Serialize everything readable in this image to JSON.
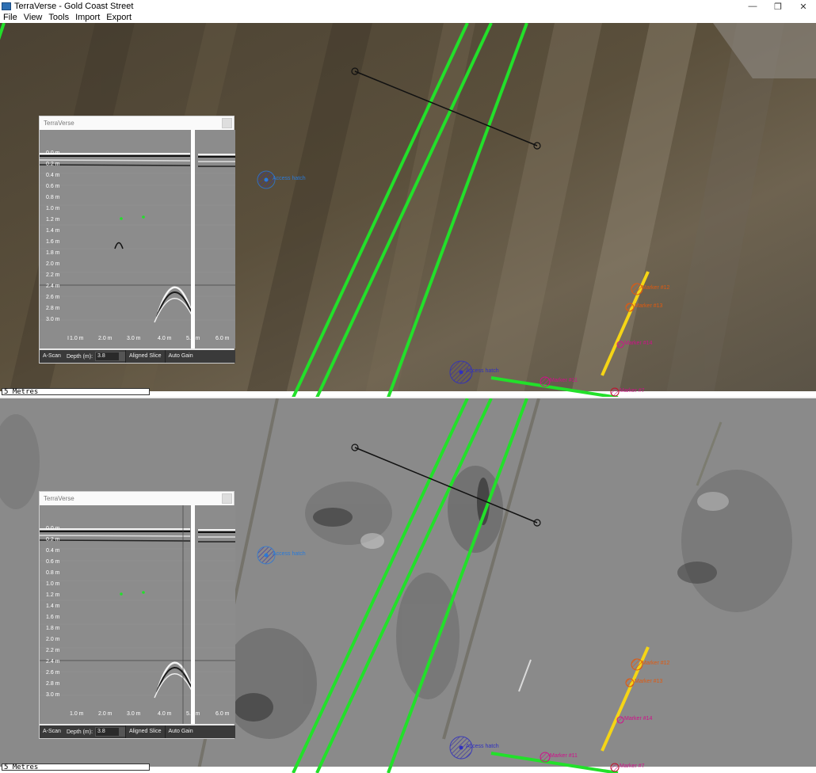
{
  "window": {
    "title": "TerraVerse - Gold Coast Street",
    "controls": {
      "minimize": "—",
      "restore": "❐",
      "close": "✕"
    }
  },
  "menu": [
    "File",
    "View",
    "Tools",
    "Import",
    "Export"
  ],
  "scale_bar": "5 Metres",
  "markers": {
    "blue": "Access hatch",
    "navy": "Access hatch",
    "orange_1": "Marker #12",
    "orange_2": "Marker #13",
    "magenta_1": "Marker #14",
    "magenta_2": "Marker #11",
    "red": "Marker #7"
  },
  "gpr": {
    "title": "TerraVerse",
    "depth_ticks": [
      "0.0 m",
      "0.2 m",
      "0.4 m",
      "0.6 m",
      "0.8 m",
      "1.0 m",
      "1.2 m",
      "1.4 m",
      "1.6 m",
      "1.8 m",
      "2.0 m",
      "2.2 m",
      "2.4 m",
      "2.6 m",
      "2.8 m",
      "3.0 m"
    ],
    "distance_ticks": [
      "1.0 m",
      "2.0 m",
      "3.0 m",
      "4.0 m",
      "5.0 m",
      "6.0 m"
    ],
    "toolbar": {
      "ascan": "A-Scan",
      "depth_label": "Depth (m):",
      "depth_value": "3.8",
      "aligned_slice": "Aligned Slice",
      "auto_gain": "Auto Gain"
    }
  },
  "colors": {
    "utility_line": "#22e02a",
    "yellow_line": "#f5d516",
    "measure_line": "#111111",
    "top_pane_base": "#4e4535",
    "bottom_pane_base": "#8a8a8a"
  }
}
